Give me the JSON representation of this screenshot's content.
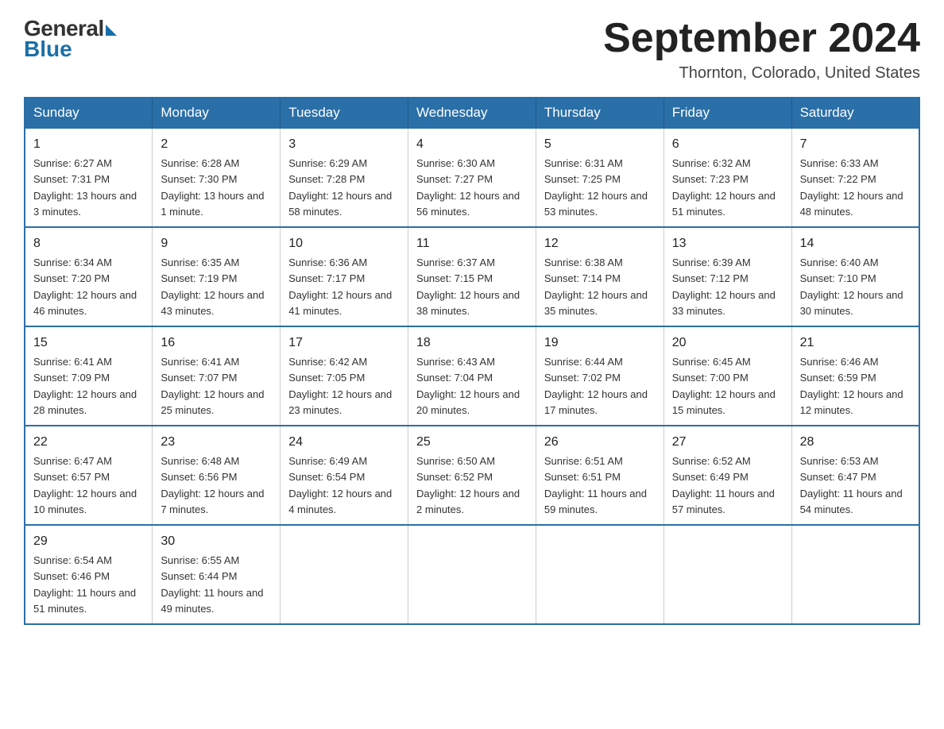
{
  "header": {
    "logo_general": "General",
    "logo_blue": "Blue",
    "month_title": "September 2024",
    "location": "Thornton, Colorado, United States"
  },
  "days_of_week": [
    "Sunday",
    "Monday",
    "Tuesday",
    "Wednesday",
    "Thursday",
    "Friday",
    "Saturday"
  ],
  "weeks": [
    [
      {
        "day": "1",
        "sunrise": "Sunrise: 6:27 AM",
        "sunset": "Sunset: 7:31 PM",
        "daylight": "Daylight: 13 hours and 3 minutes."
      },
      {
        "day": "2",
        "sunrise": "Sunrise: 6:28 AM",
        "sunset": "Sunset: 7:30 PM",
        "daylight": "Daylight: 13 hours and 1 minute."
      },
      {
        "day": "3",
        "sunrise": "Sunrise: 6:29 AM",
        "sunset": "Sunset: 7:28 PM",
        "daylight": "Daylight: 12 hours and 58 minutes."
      },
      {
        "day": "4",
        "sunrise": "Sunrise: 6:30 AM",
        "sunset": "Sunset: 7:27 PM",
        "daylight": "Daylight: 12 hours and 56 minutes."
      },
      {
        "day": "5",
        "sunrise": "Sunrise: 6:31 AM",
        "sunset": "Sunset: 7:25 PM",
        "daylight": "Daylight: 12 hours and 53 minutes."
      },
      {
        "day": "6",
        "sunrise": "Sunrise: 6:32 AM",
        "sunset": "Sunset: 7:23 PM",
        "daylight": "Daylight: 12 hours and 51 minutes."
      },
      {
        "day": "7",
        "sunrise": "Sunrise: 6:33 AM",
        "sunset": "Sunset: 7:22 PM",
        "daylight": "Daylight: 12 hours and 48 minutes."
      }
    ],
    [
      {
        "day": "8",
        "sunrise": "Sunrise: 6:34 AM",
        "sunset": "Sunset: 7:20 PM",
        "daylight": "Daylight: 12 hours and 46 minutes."
      },
      {
        "day": "9",
        "sunrise": "Sunrise: 6:35 AM",
        "sunset": "Sunset: 7:19 PM",
        "daylight": "Daylight: 12 hours and 43 minutes."
      },
      {
        "day": "10",
        "sunrise": "Sunrise: 6:36 AM",
        "sunset": "Sunset: 7:17 PM",
        "daylight": "Daylight: 12 hours and 41 minutes."
      },
      {
        "day": "11",
        "sunrise": "Sunrise: 6:37 AM",
        "sunset": "Sunset: 7:15 PM",
        "daylight": "Daylight: 12 hours and 38 minutes."
      },
      {
        "day": "12",
        "sunrise": "Sunrise: 6:38 AM",
        "sunset": "Sunset: 7:14 PM",
        "daylight": "Daylight: 12 hours and 35 minutes."
      },
      {
        "day": "13",
        "sunrise": "Sunrise: 6:39 AM",
        "sunset": "Sunset: 7:12 PM",
        "daylight": "Daylight: 12 hours and 33 minutes."
      },
      {
        "day": "14",
        "sunrise": "Sunrise: 6:40 AM",
        "sunset": "Sunset: 7:10 PM",
        "daylight": "Daylight: 12 hours and 30 minutes."
      }
    ],
    [
      {
        "day": "15",
        "sunrise": "Sunrise: 6:41 AM",
        "sunset": "Sunset: 7:09 PM",
        "daylight": "Daylight: 12 hours and 28 minutes."
      },
      {
        "day": "16",
        "sunrise": "Sunrise: 6:41 AM",
        "sunset": "Sunset: 7:07 PM",
        "daylight": "Daylight: 12 hours and 25 minutes."
      },
      {
        "day": "17",
        "sunrise": "Sunrise: 6:42 AM",
        "sunset": "Sunset: 7:05 PM",
        "daylight": "Daylight: 12 hours and 23 minutes."
      },
      {
        "day": "18",
        "sunrise": "Sunrise: 6:43 AM",
        "sunset": "Sunset: 7:04 PM",
        "daylight": "Daylight: 12 hours and 20 minutes."
      },
      {
        "day": "19",
        "sunrise": "Sunrise: 6:44 AM",
        "sunset": "Sunset: 7:02 PM",
        "daylight": "Daylight: 12 hours and 17 minutes."
      },
      {
        "day": "20",
        "sunrise": "Sunrise: 6:45 AM",
        "sunset": "Sunset: 7:00 PM",
        "daylight": "Daylight: 12 hours and 15 minutes."
      },
      {
        "day": "21",
        "sunrise": "Sunrise: 6:46 AM",
        "sunset": "Sunset: 6:59 PM",
        "daylight": "Daylight: 12 hours and 12 minutes."
      }
    ],
    [
      {
        "day": "22",
        "sunrise": "Sunrise: 6:47 AM",
        "sunset": "Sunset: 6:57 PM",
        "daylight": "Daylight: 12 hours and 10 minutes."
      },
      {
        "day": "23",
        "sunrise": "Sunrise: 6:48 AM",
        "sunset": "Sunset: 6:56 PM",
        "daylight": "Daylight: 12 hours and 7 minutes."
      },
      {
        "day": "24",
        "sunrise": "Sunrise: 6:49 AM",
        "sunset": "Sunset: 6:54 PM",
        "daylight": "Daylight: 12 hours and 4 minutes."
      },
      {
        "day": "25",
        "sunrise": "Sunrise: 6:50 AM",
        "sunset": "Sunset: 6:52 PM",
        "daylight": "Daylight: 12 hours and 2 minutes."
      },
      {
        "day": "26",
        "sunrise": "Sunrise: 6:51 AM",
        "sunset": "Sunset: 6:51 PM",
        "daylight": "Daylight: 11 hours and 59 minutes."
      },
      {
        "day": "27",
        "sunrise": "Sunrise: 6:52 AM",
        "sunset": "Sunset: 6:49 PM",
        "daylight": "Daylight: 11 hours and 57 minutes."
      },
      {
        "day": "28",
        "sunrise": "Sunrise: 6:53 AM",
        "sunset": "Sunset: 6:47 PM",
        "daylight": "Daylight: 11 hours and 54 minutes."
      }
    ],
    [
      {
        "day": "29",
        "sunrise": "Sunrise: 6:54 AM",
        "sunset": "Sunset: 6:46 PM",
        "daylight": "Daylight: 11 hours and 51 minutes."
      },
      {
        "day": "30",
        "sunrise": "Sunrise: 6:55 AM",
        "sunset": "Sunset: 6:44 PM",
        "daylight": "Daylight: 11 hours and 49 minutes."
      },
      null,
      null,
      null,
      null,
      null
    ]
  ]
}
